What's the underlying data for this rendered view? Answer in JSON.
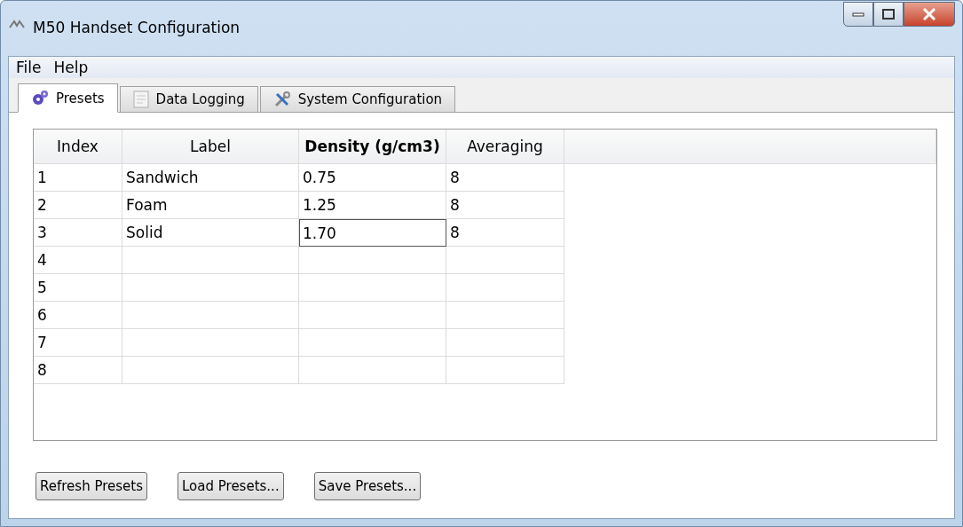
{
  "window": {
    "title": "M50 Handset Configuration"
  },
  "menu": [
    {
      "label": "File"
    },
    {
      "label": "Help"
    }
  ],
  "tabs": [
    {
      "label": "Presets",
      "selected": true
    },
    {
      "label": "Data Logging",
      "selected": false
    },
    {
      "label": "System Configuration",
      "selected": false
    }
  ],
  "table": {
    "columns": [
      {
        "label": "Index",
        "selected": false
      },
      {
        "label": "Label",
        "selected": false
      },
      {
        "label": "Density (g/cm3)",
        "selected": true
      },
      {
        "label": "Averaging",
        "selected": false
      }
    ],
    "rows": [
      {
        "cells": [
          {
            "text": "1",
            "editing": false
          },
          {
            "text": "Sandwich",
            "editing": false
          },
          {
            "text": "0.75",
            "editing": false
          },
          {
            "text": "8",
            "editing": false
          }
        ]
      },
      {
        "cells": [
          {
            "text": "2",
            "editing": false
          },
          {
            "text": "Foam",
            "editing": false
          },
          {
            "text": "1.25",
            "editing": false
          },
          {
            "text": "8",
            "editing": false
          }
        ]
      },
      {
        "cells": [
          {
            "text": "3",
            "editing": false
          },
          {
            "text": "Solid",
            "editing": false
          },
          {
            "text": "1.70",
            "editing": true
          },
          {
            "text": "8",
            "editing": false
          }
        ]
      },
      {
        "cells": [
          {
            "text": "4",
            "editing": false
          }
        ]
      },
      {
        "cells": [
          {
            "text": "5",
            "editing": false
          }
        ]
      },
      {
        "cells": [
          {
            "text": "6",
            "editing": false
          }
        ]
      },
      {
        "cells": [
          {
            "text": "7",
            "editing": false
          }
        ]
      },
      {
        "cells": [
          {
            "text": "8",
            "editing": false
          }
        ]
      }
    ]
  },
  "buttons": [
    "Refresh Presets",
    "Load Presets...",
    "Save Presets..."
  ]
}
